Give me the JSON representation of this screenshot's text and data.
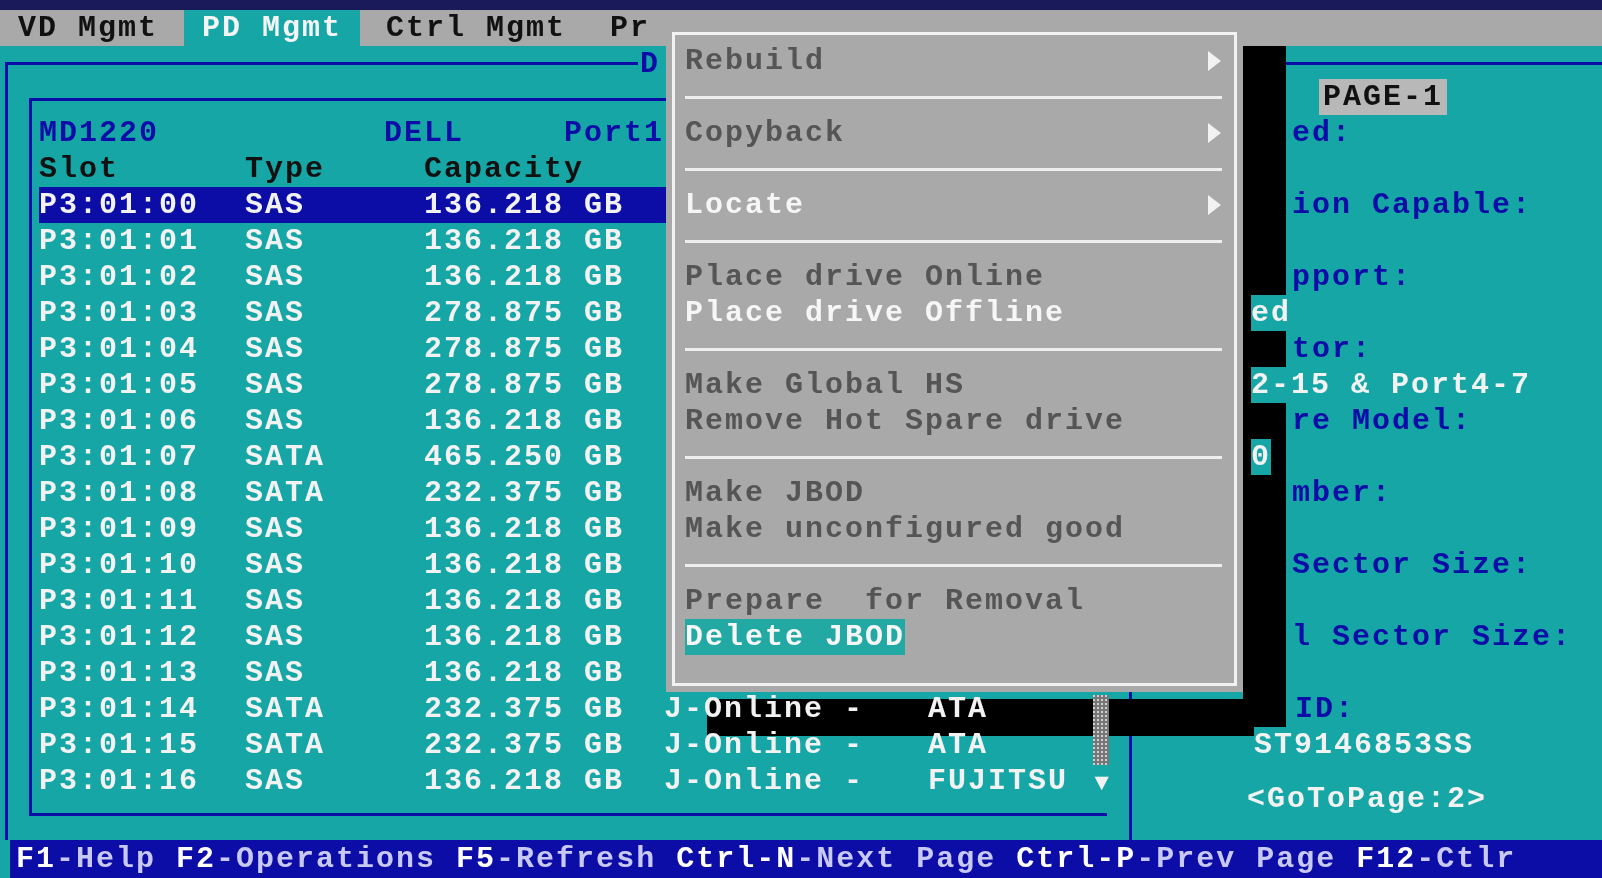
{
  "tabs": [
    {
      "label": "VD Mgmt",
      "selected": false
    },
    {
      "label": "PD Mgmt",
      "selected": true
    },
    {
      "label": "Ctrl Mgmt",
      "selected": false
    },
    {
      "label": "Pr",
      "selected": false
    }
  ],
  "frame_title": "D",
  "enclosure": {
    "name": "MD1220",
    "vendor": "DELL",
    "port": "Port1"
  },
  "columns": [
    "Slot",
    "Type",
    "Capacity"
  ],
  "rows": [
    {
      "slot": "P3:01:00",
      "type": "SAS",
      "capacity": "136.218 GB",
      "selected": true
    },
    {
      "slot": "P3:01:01",
      "type": "SAS",
      "capacity": "136.218 GB",
      "selected": false
    },
    {
      "slot": "P3:01:02",
      "type": "SAS",
      "capacity": "136.218 GB",
      "selected": false
    },
    {
      "slot": "P3:01:03",
      "type": "SAS",
      "capacity": "278.875 GB",
      "selected": false
    },
    {
      "slot": "P3:01:04",
      "type": "SAS",
      "capacity": "278.875 GB",
      "selected": false
    },
    {
      "slot": "P3:01:05",
      "type": "SAS",
      "capacity": "278.875 GB",
      "selected": false
    },
    {
      "slot": "P3:01:06",
      "type": "SAS",
      "capacity": "136.218 GB",
      "selected": false
    },
    {
      "slot": "P3:01:07",
      "type": "SATA",
      "capacity": "465.250 GB",
      "selected": false
    },
    {
      "slot": "P3:01:08",
      "type": "SATA",
      "capacity": "232.375 GB",
      "selected": false
    },
    {
      "slot": "P3:01:09",
      "type": "SAS",
      "capacity": "136.218 GB",
      "selected": false
    },
    {
      "slot": "P3:01:10",
      "type": "SAS",
      "capacity": "136.218 GB",
      "selected": false
    },
    {
      "slot": "P3:01:11",
      "type": "SAS",
      "capacity": "136.218 GB",
      "selected": false
    },
    {
      "slot": "P3:01:12",
      "type": "SAS",
      "capacity": "136.218 GB",
      "selected": false
    },
    {
      "slot": "P3:01:13",
      "type": "SAS",
      "capacity": "136.218 GB",
      "selected": false
    },
    {
      "slot": "P3:01:14",
      "type": "SATA",
      "capacity": "232.375 GB",
      "state": "J-Online -",
      "vendor": "ATA",
      "selected": false
    },
    {
      "slot": "P3:01:15",
      "type": "SATA",
      "capacity": "232.375 GB",
      "state": "J-Online -",
      "vendor": "ATA",
      "selected": false
    },
    {
      "slot": "P3:01:16",
      "type": "SAS",
      "capacity": "136.218 GB",
      "state": "J-Online -",
      "vendor": "FUJITSU",
      "selected": false
    }
  ],
  "scroll_glyph": "▼",
  "right_panel": {
    "page_label": "PAGE-1",
    "fields": [
      {
        "label": "ed:"
      },
      {
        "label": "ion Capable:"
      },
      {
        "label": "pport:",
        "value": "ed"
      },
      {
        "label": "tor:",
        "value": "2-15 & Port4-7"
      },
      {
        "label": "re Model:",
        "value": "0"
      },
      {
        "label": "mber:"
      },
      {
        "label": "Sector Size:"
      },
      {
        "label": "l Sector Size:"
      },
      {
        "label": "ID:",
        "value": "ST9146853SS"
      }
    ],
    "goto": "<GoToPage:2>"
  },
  "menu": [
    [
      {
        "label": "Rebuild",
        "enabled": false,
        "submenu": true,
        "selected": false
      }
    ],
    [
      {
        "label": "Copyback",
        "enabled": false,
        "submenu": true,
        "selected": false
      }
    ],
    [
      {
        "label": "Locate",
        "enabled": true,
        "submenu": true,
        "selected": false
      }
    ],
    [
      {
        "label": "Place drive Online",
        "enabled": false,
        "submenu": false,
        "selected": false
      },
      {
        "label": "Place drive Offline",
        "enabled": true,
        "submenu": false,
        "selected": false
      }
    ],
    [
      {
        "label": "Make Global HS",
        "enabled": false,
        "submenu": false,
        "selected": false
      },
      {
        "label": "Remove Hot Spare drive",
        "enabled": false,
        "submenu": false,
        "selected": false
      }
    ],
    [
      {
        "label": "Make JBOD",
        "enabled": false,
        "submenu": false,
        "selected": false
      },
      {
        "label": "Make unconfigured good",
        "enabled": false,
        "submenu": false,
        "selected": false
      }
    ],
    [
      {
        "label": "Prepare  for Removal",
        "enabled": false,
        "submenu": false,
        "selected": false
      },
      {
        "label": "Delete JBOD",
        "enabled": true,
        "submenu": false,
        "selected": true
      }
    ]
  ],
  "status_bar": [
    {
      "key": "F1",
      "label": "-Help"
    },
    {
      "key": "F2",
      "label": "-Operations"
    },
    {
      "key": "F5",
      "label": "-Refresh"
    },
    {
      "key": "Ctrl-N",
      "label": "-Next Page"
    },
    {
      "key": "Ctrl-P",
      "label": "-Prev Page"
    },
    {
      "key": "F12",
      "label": "-Ctlr"
    }
  ]
}
